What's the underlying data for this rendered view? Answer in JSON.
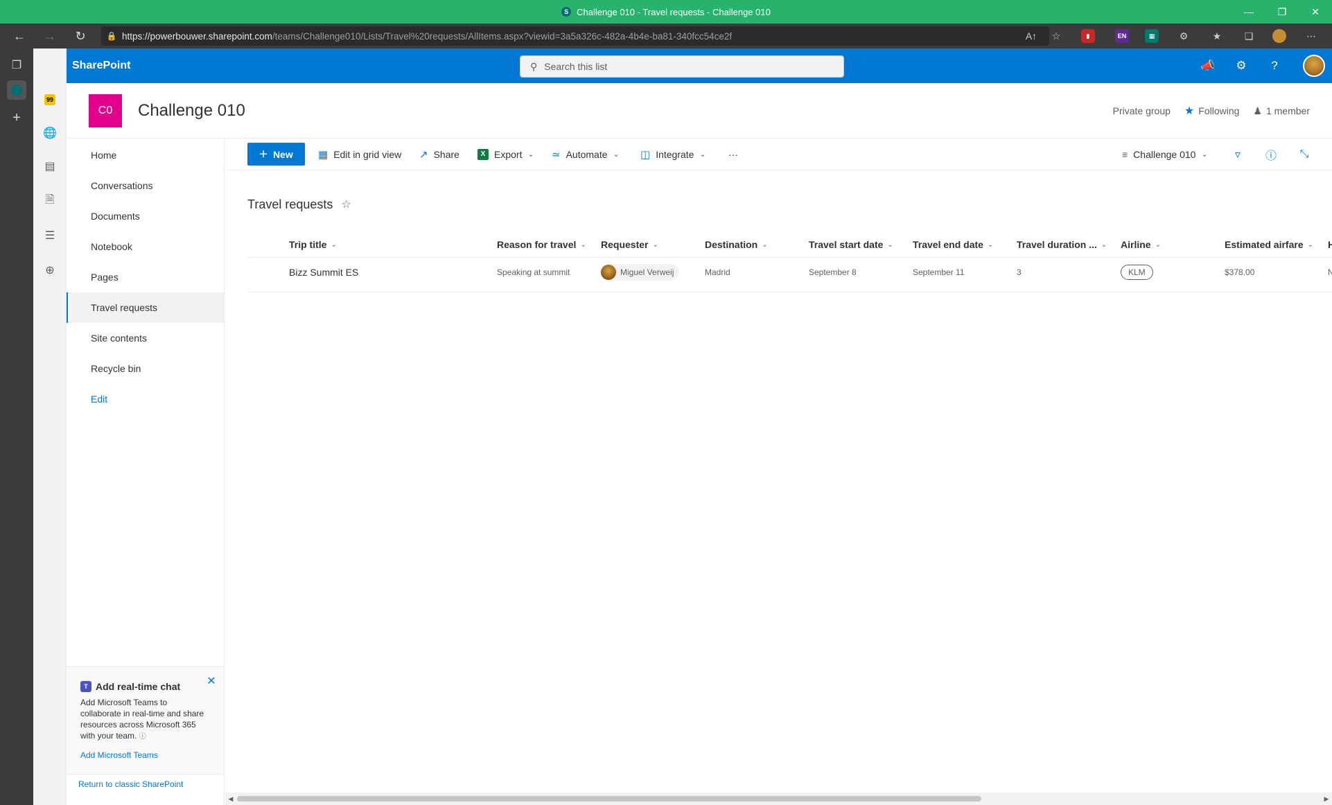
{
  "window": {
    "title": "Challenge 010 - Travel requests - Challenge 010",
    "favicon_letter": "S"
  },
  "browser": {
    "url_host": "https://powerbouwer.sharepoint.com",
    "url_path": "/teams/Challenge010/Lists/Travel%20requests/AllItems.aspx?viewid=3a5a326c-482a-4b4e-ba81-340fcc54ce2f",
    "ext_en_label": "EN"
  },
  "suite": {
    "brand": "SharePoint",
    "search_placeholder": "Search this list"
  },
  "site": {
    "logo_initials": "C0",
    "title": "Challenge 010",
    "privacy": "Private group",
    "follow_label": "Following",
    "members": "1 member"
  },
  "nav": {
    "items": [
      {
        "label": "Home"
      },
      {
        "label": "Conversations"
      },
      {
        "label": "Documents"
      },
      {
        "label": "Notebook"
      },
      {
        "label": "Pages"
      },
      {
        "label": "Travel requests"
      },
      {
        "label": "Site contents"
      },
      {
        "label": "Recycle bin"
      },
      {
        "label": "Edit"
      }
    ],
    "teams_card": {
      "title": "Add real-time chat",
      "body": "Add Microsoft Teams to collaborate in real-time and share resources across Microsoft 365 with your team.",
      "link": "Add Microsoft Teams"
    },
    "classic_link": "Return to classic SharePoint"
  },
  "commands": {
    "new": "New",
    "edit_grid": "Edit in grid view",
    "share": "Share",
    "export": "Export",
    "automate": "Automate",
    "integrate": "Integrate",
    "more": "···",
    "view_name": "Challenge 010"
  },
  "list": {
    "title": "Travel requests",
    "columns": [
      "Trip title",
      "Reason for travel",
      "Requester",
      "Destination",
      "Travel start date",
      "Travel end date",
      "Travel duration ...",
      "Airline",
      "Estimated airfare",
      "H"
    ],
    "rows": [
      {
        "trip_title": "Bizz Summit ES",
        "reason": "Speaking at summit",
        "requester": "Miguel Verweij",
        "destination": "Madrid",
        "start": "September 8",
        "end": "September 11",
        "duration": "3",
        "airline": "KLM",
        "airfare": "$378.00",
        "overflow": "N"
      }
    ]
  }
}
